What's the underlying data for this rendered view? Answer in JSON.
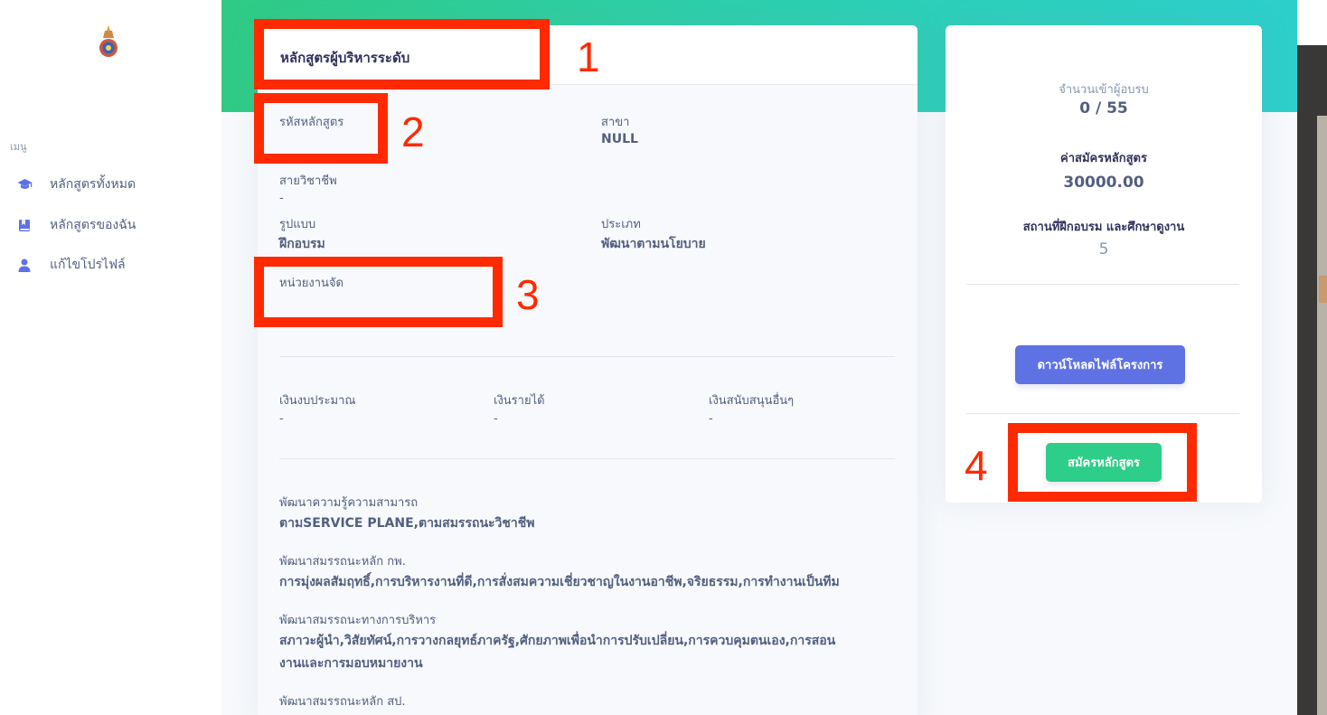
{
  "sidebar": {
    "menu_heading": "เมนู",
    "items": [
      {
        "label": "หลักสูตรทั้งหมด",
        "icon": "graduation-cap-icon"
      },
      {
        "label": "หลักสูตรของฉัน",
        "icon": "book-icon"
      },
      {
        "label": "แก้ไขโปรไฟล์",
        "icon": "user-icon"
      }
    ]
  },
  "course": {
    "title": "หลักสูตรผู้บริหารระดับ",
    "code_label": "รหัสหลักสูตร",
    "code_value": "",
    "branch_label": "สาขา",
    "branch_value": "NULL",
    "career_label": "สายวิชาชีพ",
    "career_value": "-",
    "format_label": "รูปแบบ",
    "format_value": "ฝึกอบรม",
    "type_label": "ประเภท",
    "type_value": "พัฒนาตามนโยบาย",
    "organizer_label": "หน่วยงานจัด",
    "organizer_value": ""
  },
  "budget": {
    "budget_label": "เงินงบประมาณ",
    "budget_value": "-",
    "income_label": "เงินรายได้",
    "income_value": "-",
    "other_label": "เงินสนับสนุนอื่นๆ",
    "other_value": "-"
  },
  "competencies": [
    {
      "label": "พัฒนาความรู้ความสามารถ",
      "value": "ตามSERVICE PLANE,ตามสมรรถนะวิชาชีพ"
    },
    {
      "label": "พัฒนาสมรรถนะหลัก กพ.",
      "value": "การมุ่งผลสัมฤทธิ์,การบริหารงานที่ดี,การสั่งสมความเชี่ยวชาญในงานอาชีพ,จริยธรรม,การทำงานเป็นทีม"
    },
    {
      "label": "พัฒนาสมรรถนะทางการบริหาร",
      "value_line1": "สภาวะผู้นำ,วิสัยทัศน์,การวางกลยุทธ์ภาครัฐ,ศักยภาพเพื่อนำการปรับเปลี่ยน,การควบคุมตนเอง,การสอน",
      "value_line2": "งานและการมอบหมายงาน"
    },
    {
      "label": "พัฒนาสมรรถนะหลัก สป.",
      "value": ""
    }
  ],
  "side": {
    "enrolled_label": "จำนวนเข้าผู้อบรบ",
    "enrolled_value": "0 / 55",
    "fee_label": "ค่าสมัครหลักสูตร",
    "fee_value": "30000.00",
    "location_label": "สถานที่ฝึกอบรม และศึกษาดูงาน",
    "location_value": "5",
    "download_button": "ดาวน์โหลดไฟล์โครงการ",
    "apply_button": "สมัครหลักสูตร"
  },
  "annotations": [
    "1",
    "2",
    "3",
    "4"
  ],
  "colors": {
    "annotation": "#ff2a00",
    "primary": "#5e72e4",
    "success": "#2dce89",
    "header_gradient_start": "#2fcb85",
    "header_gradient_end": "#2dcfcc"
  }
}
